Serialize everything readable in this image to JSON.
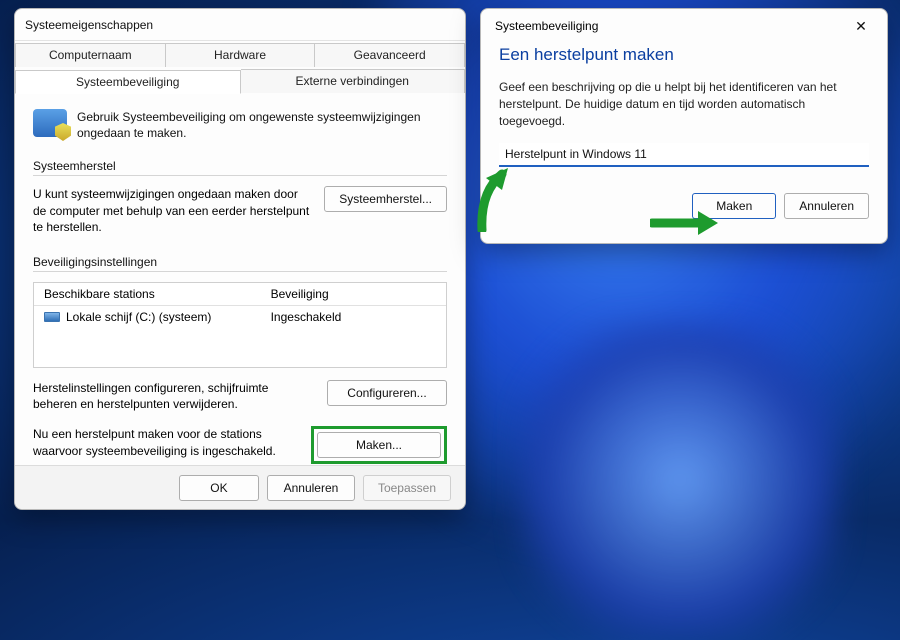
{
  "window1": {
    "title": "Systeemeigenschappen",
    "tabs_top": [
      "Computernaam",
      "Hardware",
      "Geavanceerd"
    ],
    "tabs_bottom": [
      "Systeembeveiliging",
      "Externe verbindingen"
    ],
    "active_tab": "Systeembeveiliging",
    "intro": "Gebruik Systeembeveiliging om ongewenste systeemwijzigingen ongedaan te maken.",
    "section_restore_title": "Systeemherstel",
    "restore_desc": "U kunt systeemwijzigingen ongedaan maken door de computer met behulp van een eerder herstelpunt te herstellen.",
    "restore_btn": "Systeemherstel...",
    "section_settings_title": "Beveiligingsinstellingen",
    "table": {
      "headers": [
        "Beschikbare stations",
        "Beveiliging"
      ],
      "row": {
        "drive": "Lokale schijf (C:) (systeem)",
        "status": "Ingeschakeld"
      }
    },
    "configure_desc": "Herstelinstellingen configureren, schijfruimte beheren en herstelpunten verwijderen.",
    "configure_btn": "Configureren...",
    "create_desc": "Nu een herstelpunt maken voor de stations waarvoor systeembeveiliging is ingeschakeld.",
    "create_btn": "Maken...",
    "ok": "OK",
    "cancel": "Annuleren",
    "apply": "Toepassen"
  },
  "window2": {
    "title": "Systeembeveiliging",
    "heading": "Een herstelpunt maken",
    "desc": "Geef een beschrijving op die u helpt bij het identificeren van het herstelpunt. De huidige datum en tijd worden automatisch toegevoegd.",
    "input_value": "Herstelpunt in Windows 11",
    "make": "Maken",
    "cancel": "Annuleren"
  },
  "colors": {
    "accent_green": "#1e9b2e",
    "accent_blue": "#0a3ea0"
  }
}
